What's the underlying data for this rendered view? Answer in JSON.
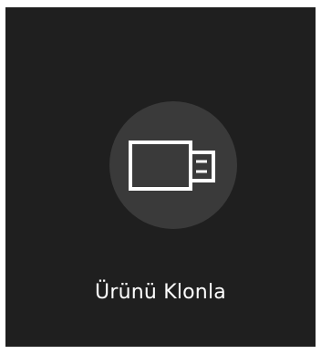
{
  "menu_item": {
    "label": "Ürünü Klonla",
    "icon": "usb-drive-icon"
  },
  "colors": {
    "panel_background": "#1f1f1f",
    "icon_circle": "#3a3a3a",
    "foreground": "#ffffff"
  }
}
